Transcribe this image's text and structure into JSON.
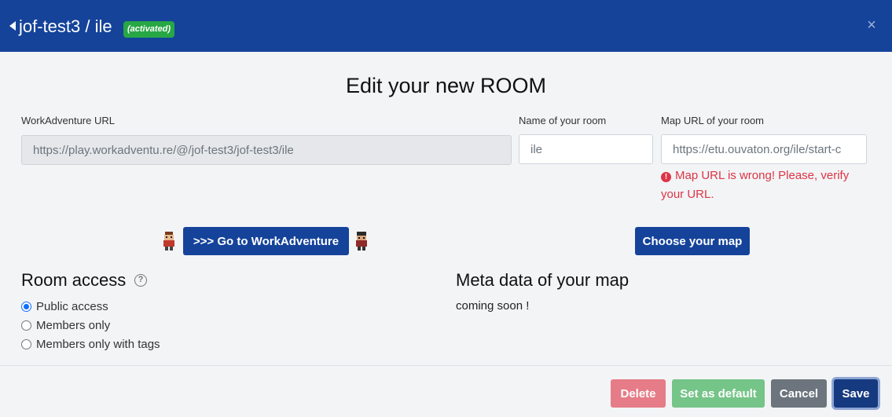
{
  "header": {
    "title": "jof-test3 / ile",
    "badge": "(activated)",
    "close_symbol": "×",
    "icons": {
      "back": "back-arrow-icon",
      "close": "close-icon"
    }
  },
  "modal": {
    "title": "Edit your new ROOM"
  },
  "form": {
    "workadventure_url": {
      "label": "WorkAdventure URL",
      "value": "https://play.workadventu.re/@/jof-test3/jof-test3/ile"
    },
    "room_name": {
      "label": "Name of your room",
      "value": "ile"
    },
    "map_url": {
      "label": "Map URL of your room",
      "value": "https://etu.ouvaton.org/ile/start-c"
    },
    "map_url_error": "Map URL is wrong! Please, verify your URL.",
    "error_symbol": "!"
  },
  "actions": {
    "go_to_workadventure": ">>> Go to WorkAdventure",
    "choose_map": "Choose your map"
  },
  "room_access": {
    "title": "Room access",
    "help_symbol": "?",
    "options": [
      {
        "label": "Public access",
        "checked": true
      },
      {
        "label": "Members only",
        "checked": false
      },
      {
        "label": "Members only with tags",
        "checked": false
      }
    ]
  },
  "meta_data": {
    "title": "Meta data of your map",
    "text": "coming soon !"
  },
  "footer": {
    "delete": "Delete",
    "set_default": "Set as default",
    "cancel": "Cancel",
    "save": "Save"
  },
  "colors": {
    "header_bg": "#15439a",
    "primary": "#15439a",
    "success_badge": "#28a745",
    "danger_text": "#dc3545",
    "delete_btn": "#e67c87",
    "default_btn": "#75c488",
    "cancel_btn": "#6c757d",
    "save_btn": "#153a80"
  }
}
